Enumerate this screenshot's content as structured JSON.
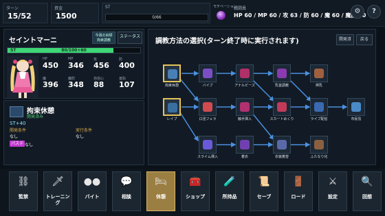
{
  "topbar": {
    "turn_label": "ターン",
    "turn_value": "15/52",
    "money_label": "資金",
    "money_value": "1500",
    "st_label": "ST",
    "st_value": "0/66",
    "motivation_label": "モチベーション",
    "motivation_value": 0.4,
    "battle_label": "戦闘員",
    "battle_stats": "HP 60 / MP 60 / 攻 63 / 防 60 / 魔 60 / 魔防 60",
    "buttons": [
      "⚙",
      "?"
    ]
  },
  "character": {
    "name": "セイントマーニ",
    "btn_today": "今週の目標\n拘束調教",
    "btn_status": "ステータス",
    "st_label": "ST",
    "st_text": "80/100+60",
    "st_fraction": 0.8,
    "stats": [
      {
        "label": "HP",
        "value": "450"
      },
      {
        "label": "MP",
        "value": "346"
      },
      {
        "label": "攻",
        "value": "456"
      },
      {
        "label": "防",
        "value": "400"
      },
      {
        "label": "魔",
        "value": "396"
      },
      {
        "label": "魔防",
        "value": "348"
      },
      {
        "label": "自信心",
        "value": "88"
      },
      {
        "label": "羞恥",
        "value": "107"
      }
    ]
  },
  "rest": {
    "name": "拘束休憩",
    "sub": "開発済み",
    "st_gain": "ST+40",
    "dev_cond_label": "開発条件",
    "dev_cond_value": "なし",
    "exec_cond_label": "実行条件",
    "exec_cond_value": "なし",
    "badge": "パステ",
    "badge_value": "なし"
  },
  "tree": {
    "title": "調教方法の選択(ターン終了時に実行されます)",
    "btn_developed": "開発済",
    "btn_back": "戻る",
    "nodes": [
      {
        "name": "拘束休憩",
        "color": "#4a7fb5"
      },
      {
        "name": "バイブ",
        "color": "#7a4fc4"
      },
      {
        "name": "アナルビーズ",
        "color": "#b0306a"
      },
      {
        "name": "乳首調教",
        "color": "#8a3ab0"
      },
      {
        "name": "搾乳",
        "color": "#a06040"
      },
      {
        "name": "レイプ",
        "color": "#3b6fa0"
      },
      {
        "name": "口淫フェラ",
        "color": "#d04a50"
      },
      {
        "name": "触手挿入",
        "color": "#b03070"
      },
      {
        "name": "スカートめくり",
        "color": "#c03a5a"
      },
      {
        "name": "ライブ配信",
        "color": "#3a6ab0"
      },
      {
        "name": "市民島",
        "color": "#4a8ac8"
      },
      {
        "name": "スライム挿入",
        "color": "#6a5ad8"
      },
      {
        "name": "着衣",
        "color": "#7040b0"
      },
      {
        "name": "衣装着替",
        "color": "#5a6aa8"
      },
      {
        "name": "ふたなり化",
        "color": "#8a6040"
      }
    ]
  },
  "bottom_nav": [
    {
      "icon": "⛓",
      "label": "監禁"
    },
    {
      "icon": "🗡",
      "label": "トレーニング"
    },
    {
      "icon": "●●",
      "label": "バイト"
    },
    {
      "icon": "💬",
      "label": "相談"
    },
    {
      "icon": "🛏",
      "label": "休憩"
    },
    {
      "icon": "🧰",
      "label": "ショップ"
    },
    {
      "icon": "🧪",
      "label": "所持品"
    },
    {
      "icon": "📜",
      "label": "セーブ"
    },
    {
      "icon": "🚪",
      "label": "ロード"
    },
    {
      "icon": "⚔",
      "label": "設定"
    },
    {
      "icon": "🔍",
      "label": "回想"
    }
  ]
}
